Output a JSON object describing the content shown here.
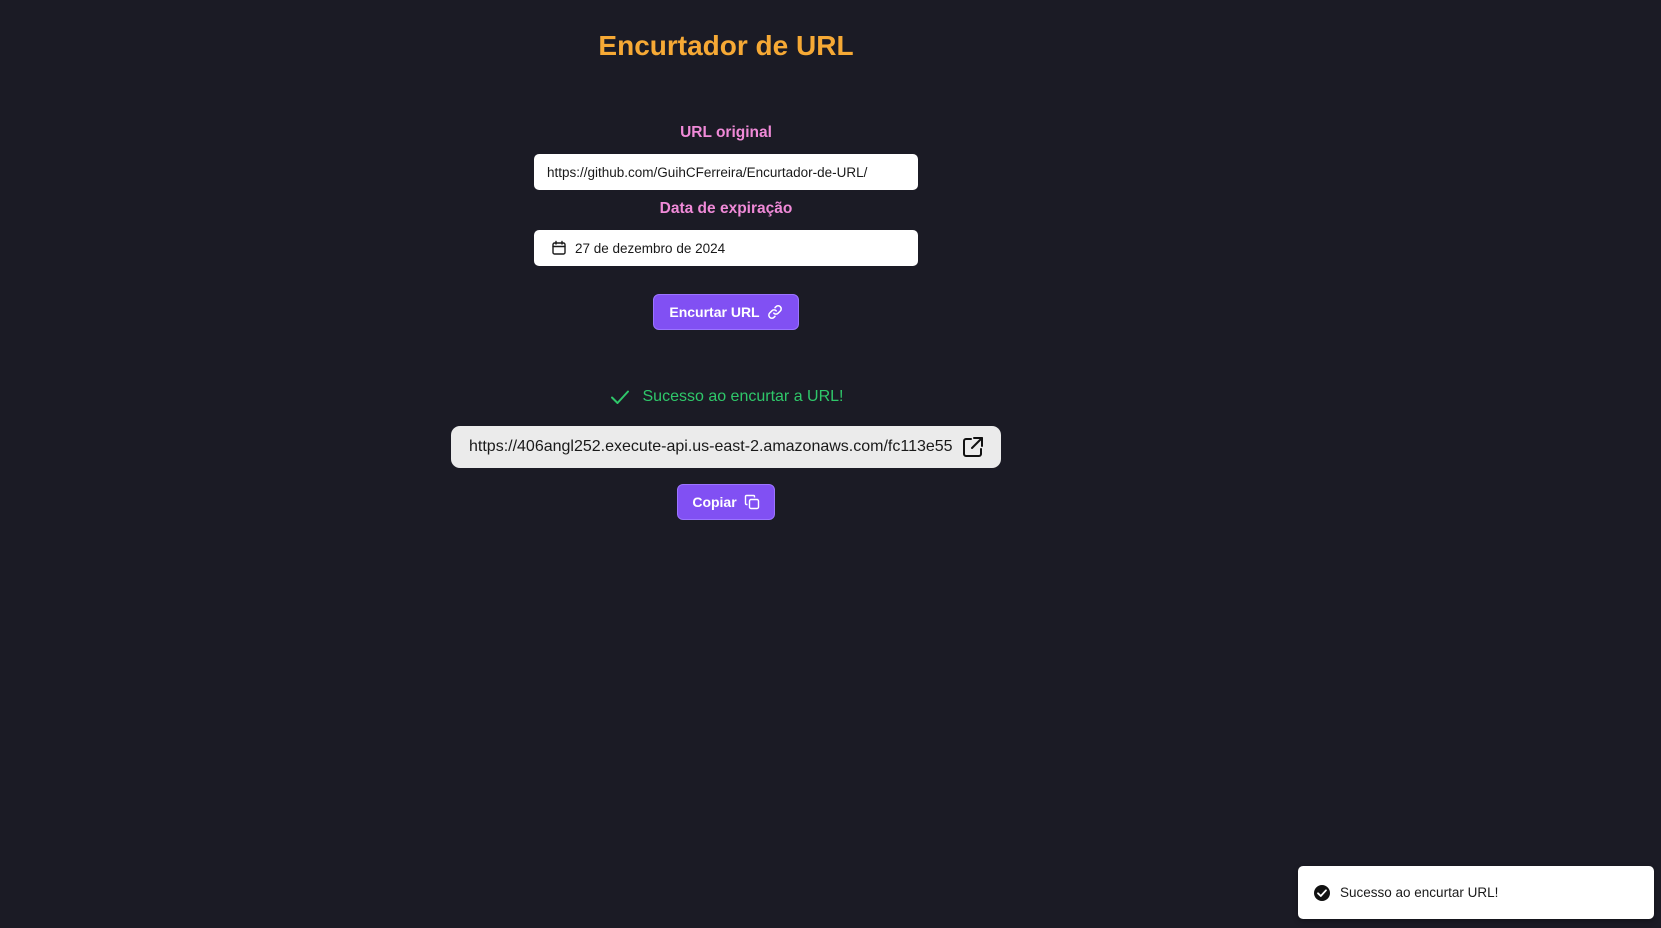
{
  "page": {
    "title": "Encurtador de URL"
  },
  "form": {
    "url_label": "URL original",
    "url_value": "https://github.com/GuihCFerreira/Encurtador-de-URL/",
    "date_label": "Data de expiração",
    "date_value": "27 de dezembro de 2024",
    "shorten_button_label": "Encurtar URL"
  },
  "result": {
    "success_message": "Sucesso ao encurtar a URL!",
    "short_url": "https://406angl252.execute-api.us-east-2.amazonaws.com/fc113e55",
    "copy_button_label": "Copiar"
  },
  "toast": {
    "message": "Sucesso ao encurtar URL!"
  },
  "icons": {
    "calendar": "calendar-icon",
    "link": "link-icon",
    "check": "check-icon",
    "external_link": "external-link-icon",
    "copy": "copy-icon",
    "toast_check": "check-circle-icon"
  },
  "colors": {
    "background": "#1b1b25",
    "title": "#f6a935",
    "label": "#f08ad8",
    "accent": "#8150f3",
    "success": "#2fc76a"
  }
}
